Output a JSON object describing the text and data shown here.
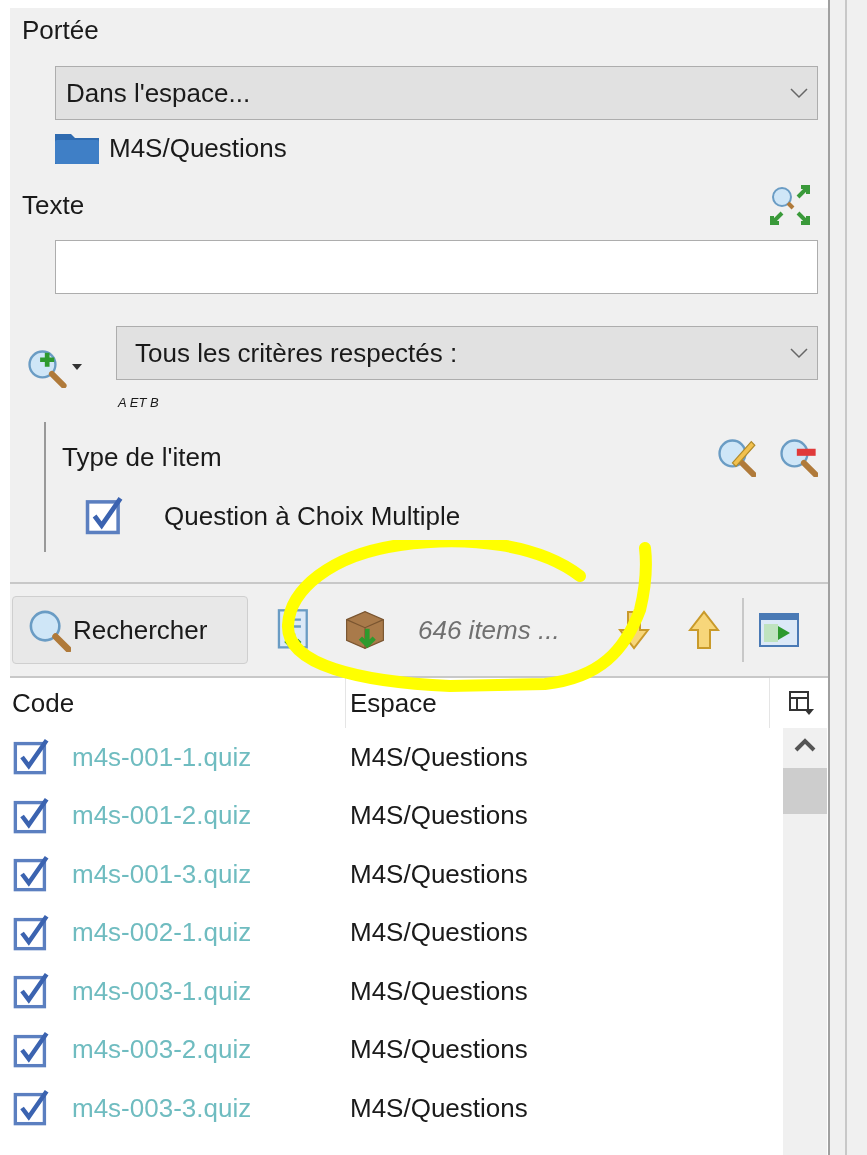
{
  "scope": {
    "label": "Portée",
    "dropdown": "Dans l'espace...",
    "folder": "M4S/Questions"
  },
  "text_search": {
    "label": "Texte"
  },
  "criteria": {
    "dropdown": "Tous les critères respectés :",
    "hint": "A ET B",
    "group": {
      "label": "Type de l'item",
      "options": [
        {
          "label": "Question à Choix Multiple",
          "checked": true
        }
      ]
    }
  },
  "toolbar": {
    "search_button": "Rechercher",
    "result_count": "646 items ..."
  },
  "table": {
    "columns": [
      "Code",
      "Espace"
    ],
    "rows": [
      {
        "checked": true,
        "code": "m4s-001-1.quiz",
        "space": "M4S/Questions"
      },
      {
        "checked": true,
        "code": "m4s-001-2.quiz",
        "space": "M4S/Questions"
      },
      {
        "checked": true,
        "code": "m4s-001-3.quiz",
        "space": "M4S/Questions"
      },
      {
        "checked": true,
        "code": "m4s-002-1.quiz",
        "space": "M4S/Questions"
      },
      {
        "checked": true,
        "code": "m4s-003-1.quiz",
        "space": "M4S/Questions"
      },
      {
        "checked": true,
        "code": "m4s-003-2.quiz",
        "space": "M4S/Questions"
      },
      {
        "checked": true,
        "code": "m4s-003-3.quiz",
        "space": "M4S/Questions"
      }
    ]
  }
}
